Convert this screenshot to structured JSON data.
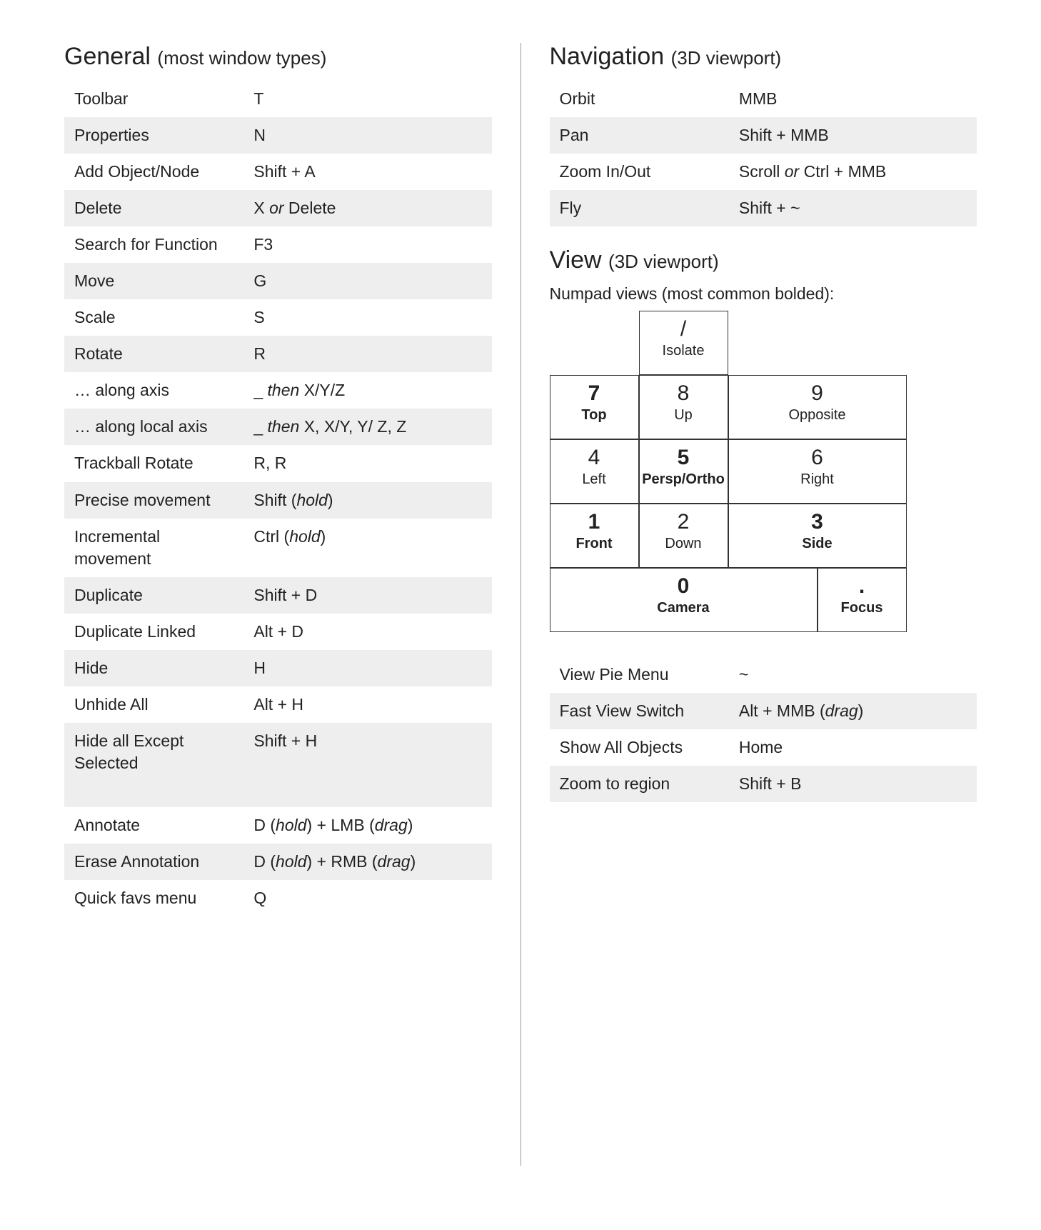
{
  "left": {
    "heading_main": "General",
    "heading_sub": "(most window types)",
    "rows": [
      {
        "label": "Toolbar",
        "key_html": "T"
      },
      {
        "label": "Properties",
        "key_html": "N"
      },
      {
        "label": "Add Object/Node",
        "key_html": "Shift + A"
      },
      {
        "label": "Delete",
        "key_html": "X <em class='it'>or</em> Delete"
      },
      {
        "label": "Search for Function",
        "key_html": "F3"
      },
      {
        "label": "Move",
        "key_html": "G"
      },
      {
        "label": "Scale",
        "key_html": "S"
      },
      {
        "label": "Rotate",
        "key_html": "R"
      },
      {
        "label": "… along axis",
        "key_html": "_ <em class='it'>then</em> X/Y/Z"
      },
      {
        "label": "… along local axis",
        "key_html": "_ <em class='it'>then</em> X, X/Y, Y/ Z, Z"
      },
      {
        "label": "Trackball Rotate",
        "key_html": "R, R"
      },
      {
        "label": "Precise movement",
        "key_html": "Shift (<em class='it'>hold</em>)"
      },
      {
        "label": "Incremental movement",
        "key_html": "Ctrl (<em class='it'>hold</em>)"
      },
      {
        "label": "Duplicate",
        "key_html": "Shift + D"
      },
      {
        "label": "Duplicate Linked",
        "key_html": "Alt + D"
      },
      {
        "label": "Hide",
        "key_html": "H"
      },
      {
        "label": "Unhide All",
        "key_html": "Alt + H"
      },
      {
        "label": "Hide all Except Selected",
        "key_html": "Shift + H",
        "extra_gap": true
      },
      {
        "label": "Annotate",
        "key_html": "D (<em class='it'>hold</em>) + LMB (<em class='it'>drag</em>)"
      },
      {
        "label": "Erase Annotation",
        "key_html": "D (<em class='it'>hold</em>) + RMB (<em class='it'>drag</em>)"
      },
      {
        "label": "Quick favs menu",
        "key_html": "Q"
      }
    ]
  },
  "right": {
    "nav": {
      "heading_main": "Navigation",
      "heading_sub": "(3D viewport)",
      "rows": [
        {
          "label": "Orbit",
          "key_html": "MMB"
        },
        {
          "label": "Pan",
          "key_html": "Shift + MMB"
        },
        {
          "label": "Zoom In/Out",
          "key_html": "Scroll <em class='it'>or</em> Ctrl + MMB"
        },
        {
          "label": "Fly",
          "key_html": "Shift + ~"
        }
      ]
    },
    "view": {
      "heading_main": "View",
      "heading_sub": "(3D viewport)",
      "caption": "Numpad views (most common bolded):",
      "numpad": {
        "top": {
          "key": "/",
          "label": "Isolate",
          "bold": false
        },
        "r1": [
          {
            "key": "7",
            "label": "Top",
            "bold": true
          },
          {
            "key": "8",
            "label": "Up",
            "bold": false
          },
          {
            "key": "9",
            "label": "Opposite",
            "bold": false
          }
        ],
        "r2": [
          {
            "key": "4",
            "label": "Left",
            "bold": false
          },
          {
            "key": "5",
            "label": "Persp/Ortho",
            "bold": true
          },
          {
            "key": "6",
            "label": "Right",
            "bold": false
          }
        ],
        "r3": [
          {
            "key": "1",
            "label": "Front",
            "bold": true
          },
          {
            "key": "2",
            "label": "Down",
            "bold": false
          },
          {
            "key": "3",
            "label": "Side",
            "bold": true
          }
        ],
        "bottom_left": {
          "key": "0",
          "label": "Camera",
          "bold": true
        },
        "bottom_right": {
          "key": ".",
          "label": "Focus",
          "bold": true
        }
      },
      "rows": [
        {
          "label": "View Pie Menu",
          "key_html": "~"
        },
        {
          "label": "Fast View Switch",
          "key_html": "Alt + MMB (<em class='it'>drag</em>)"
        },
        {
          "label": "Show All Objects",
          "key_html": "Home"
        },
        {
          "label": "Zoom to region",
          "key_html": "Shift + B"
        }
      ]
    }
  }
}
